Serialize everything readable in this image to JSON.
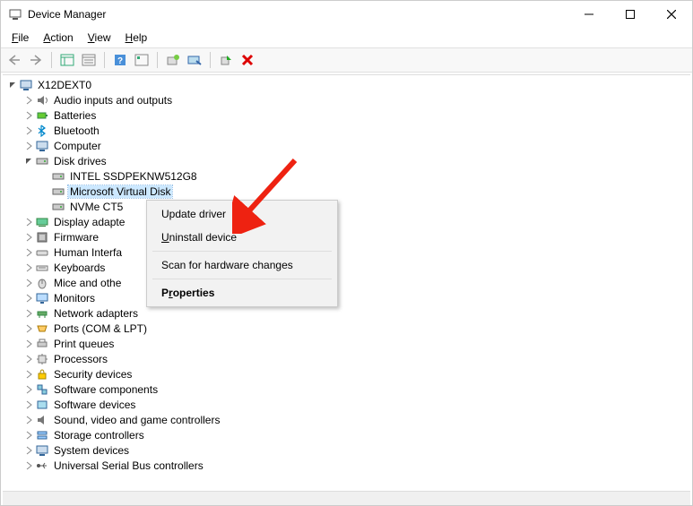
{
  "window": {
    "title": "Device Manager"
  },
  "menu": {
    "file": "File",
    "action": "Action",
    "view": "View",
    "help": "Help"
  },
  "tree": {
    "root": "X12DEXT0",
    "categories": {
      "audio": "Audio inputs and outputs",
      "batteries": "Batteries",
      "bluetooth": "Bluetooth",
      "computer": "Computer",
      "disk": "Disk drives",
      "display": "Display adapte",
      "firmware": "Firmware",
      "hid": "Human Interfa",
      "keyboards": "Keyboards",
      "mice": "Mice and othe",
      "monitors": "Monitors",
      "network": "Network adapters",
      "ports": "Ports (COM & LPT)",
      "printq": "Print queues",
      "processors": "Processors",
      "security": "Security devices",
      "swcomp": "Software components",
      "swdev": "Software devices",
      "sound": "Sound, video and game controllers",
      "storage": "Storage controllers",
      "system": "System devices",
      "usb": "Universal Serial Bus controllers"
    },
    "disk_children": {
      "d0": "INTEL SSDPEKNW512G8",
      "d1": "Microsoft Virtual Disk",
      "d2": "NVMe CT5"
    }
  },
  "context_menu": {
    "update": "Update driver",
    "uninstall": "Uninstall device",
    "scan": "Scan for hardware changes",
    "properties": "Properties"
  }
}
